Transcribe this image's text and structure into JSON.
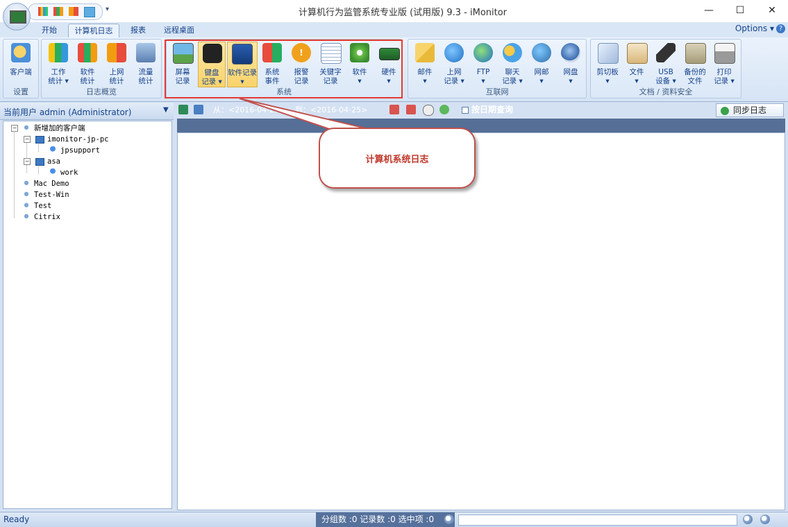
{
  "window": {
    "title": "计算机行为监管系统专业版 (试用版) 9.3 - iMonitor",
    "minimize": "—",
    "maximize": "☐",
    "close": "✕"
  },
  "tabs": [
    "开始",
    "计算机日志",
    "报表",
    "远程桌面"
  ],
  "active_tab": "计算机日志",
  "options_label": "Options ▾",
  "help_glyph": "?",
  "ribbon": {
    "groups": [
      {
        "label": "设置",
        "buttons": [
          {
            "l1": "客户端",
            "l2": ""
          }
        ]
      },
      {
        "label": "日志概览",
        "buttons": [
          {
            "l1": "工作",
            "l2": "统计 ▾"
          },
          {
            "l1": "软件",
            "l2": "统计"
          },
          {
            "l1": "上网",
            "l2": "统计"
          },
          {
            "l1": "流量",
            "l2": "统计"
          }
        ]
      },
      {
        "label": "系统",
        "buttons": [
          {
            "l1": "屏幕",
            "l2": "记录"
          },
          {
            "l1": "键盘",
            "l2": "记录 ▾"
          },
          {
            "l1": "软件记录",
            "l2": "▾"
          },
          {
            "l1": "系统",
            "l2": "事件"
          },
          {
            "l1": "报警",
            "l2": "记录"
          },
          {
            "l1": "关键字",
            "l2": "记录"
          },
          {
            "l1": "软件",
            "l2": "▾"
          },
          {
            "l1": "硬件",
            "l2": "▾"
          }
        ]
      },
      {
        "label": "互联网",
        "buttons": [
          {
            "l1": "邮件",
            "l2": "▾"
          },
          {
            "l1": "上网",
            "l2": "记录 ▾"
          },
          {
            "l1": "FTP",
            "l2": "▾"
          },
          {
            "l1": "聊天",
            "l2": "记录 ▾"
          },
          {
            "l1": "网邮",
            "l2": "▾"
          },
          {
            "l1": "网盘",
            "l2": "▾"
          }
        ]
      },
      {
        "label": "文档 / 资料安全",
        "buttons": [
          {
            "l1": "剪切板",
            "l2": "▾"
          },
          {
            "l1": "文件",
            "l2": "▾"
          },
          {
            "l1": "USB",
            "l2": "设备 ▾"
          },
          {
            "l1": "备份的",
            "l2": "文件"
          },
          {
            "l1": "打印",
            "l2": "记录 ▾"
          }
        ]
      }
    ]
  },
  "left_panel": {
    "current_user": "当前用户 admin (Administrator)",
    "tree": [
      {
        "label": "新增加的客户端",
        "level": 0,
        "type": "group",
        "expander": "−"
      },
      {
        "label": "imonitor-jp-pc",
        "level": 1,
        "type": "pc",
        "expander": "−"
      },
      {
        "label": "jpsupport",
        "level": 2,
        "type": "user",
        "expander": ""
      },
      {
        "label": "asa",
        "level": 1,
        "type": "pc",
        "expander": "−"
      },
      {
        "label": "work",
        "level": 2,
        "type": "user",
        "expander": ""
      },
      {
        "label": "Mac Demo",
        "level": 0,
        "type": "group",
        "expander": ""
      },
      {
        "label": "Test-Win",
        "level": 0,
        "type": "group",
        "expander": ""
      },
      {
        "label": "Test",
        "level": 0,
        "type": "group",
        "expander": ""
      },
      {
        "label": "Citrix",
        "level": 0,
        "type": "group",
        "expander": ""
      }
    ]
  },
  "toolbar": {
    "from_label": "从：<2016-04-25",
    "to_label": "到：<2016-04-25>",
    "date_query_label": "按日期查询",
    "sync_label": "同步日志"
  },
  "callout": {
    "text": "计算机系统日志"
  },
  "status": {
    "ready": "Ready",
    "stats": "分组数 :0  记录数 :0  选中项 :0"
  },
  "colors": {
    "highlight_border": "#e53935",
    "callout_border": "#c0504d",
    "callout_text": "#c0392b"
  }
}
